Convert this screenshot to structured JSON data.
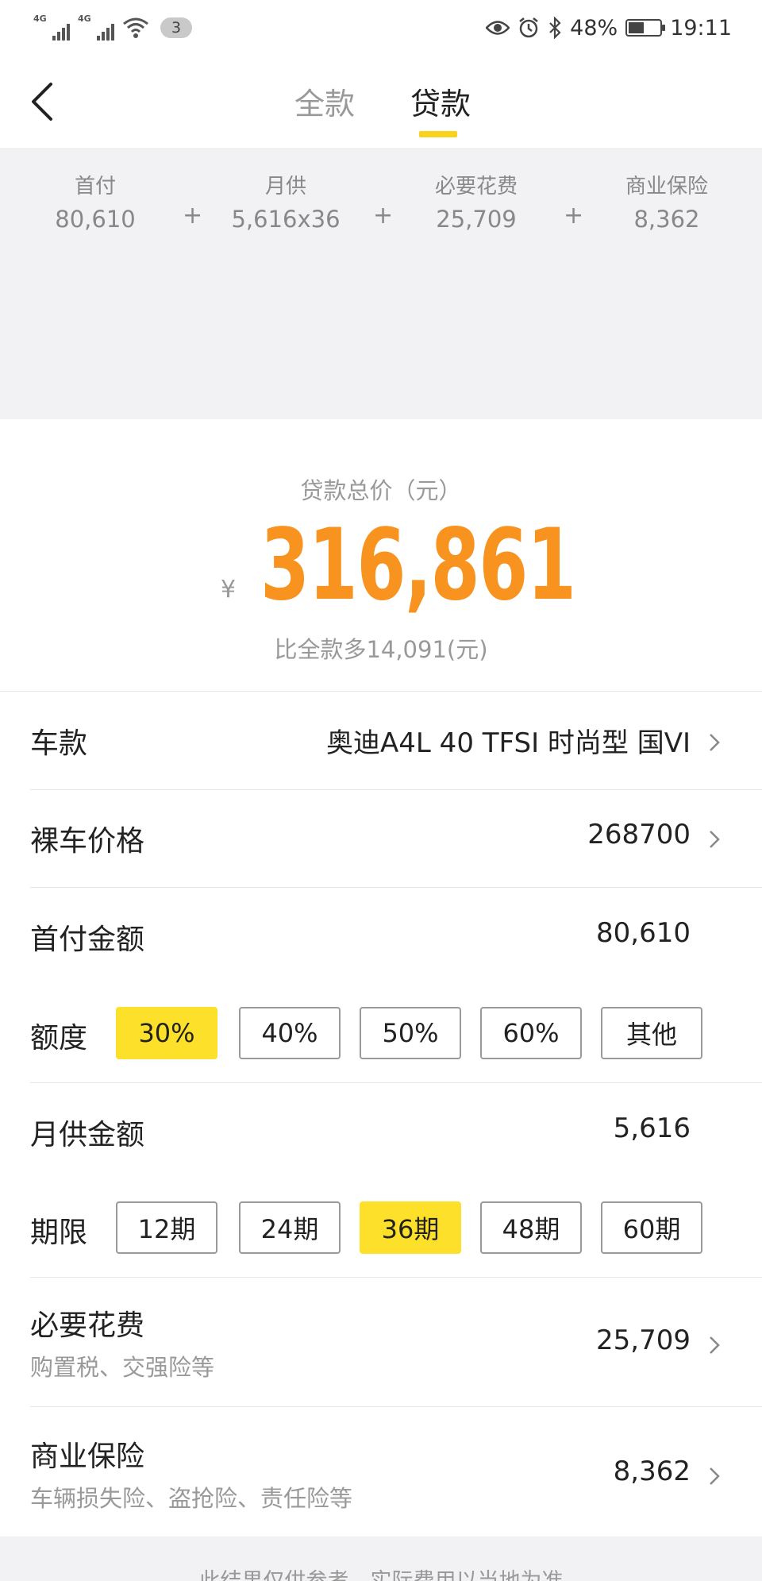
{
  "status_bar": {
    "signal1_tag": "4G",
    "signal2_tag": "4G",
    "notification_count": "3",
    "battery_percent": "48%",
    "time": "19:11",
    "icons": [
      "eye-icon",
      "alarm-icon",
      "bluetooth-icon",
      "battery-icon",
      "wifi-icon"
    ]
  },
  "header": {
    "tabs": [
      {
        "label": "全款",
        "active": false
      },
      {
        "label": "贷款",
        "active": true
      }
    ],
    "accent": "#f8d21c"
  },
  "summary": {
    "items": [
      {
        "label": "首付",
        "value": "80,610"
      },
      {
        "label": "月供",
        "value": "5,616x36"
      },
      {
        "label": "必要花费",
        "value": "25,709"
      },
      {
        "label": "商业保险",
        "value": "8,362"
      }
    ],
    "plus": "+"
  },
  "total": {
    "label": "贷款总价（元）",
    "currency": "¥",
    "value": "316,861",
    "diff": "比全款多14,091(元)",
    "color": "#f7931e"
  },
  "rows": {
    "car_model": {
      "label": "车款",
      "value": "奥迪A4L 40 TFSI 时尚型 国VI"
    },
    "bare_price": {
      "label": "裸车价格",
      "value": "268700"
    },
    "down_payment": {
      "label": "首付金额",
      "value": "80,610"
    },
    "ratio": {
      "label": "额度",
      "options": [
        "30%",
        "40%",
        "50%",
        "60%",
        "其他"
      ],
      "selected": "30%"
    },
    "monthly": {
      "label": "月供金额",
      "value": "5,616"
    },
    "term": {
      "label": "期限",
      "options": [
        "12期",
        "24期",
        "36期",
        "48期",
        "60期"
      ],
      "selected": "36期"
    },
    "necessary": {
      "label": "必要花费",
      "sub": "购置税、交强险等",
      "value": "25,709"
    },
    "insurance": {
      "label": "商业保险",
      "sub": "车辆损失险、盗抢险、责任险等",
      "value": "8,362"
    }
  },
  "footer": {
    "note": "此结果仅供参考，实际费用以当地为准"
  }
}
